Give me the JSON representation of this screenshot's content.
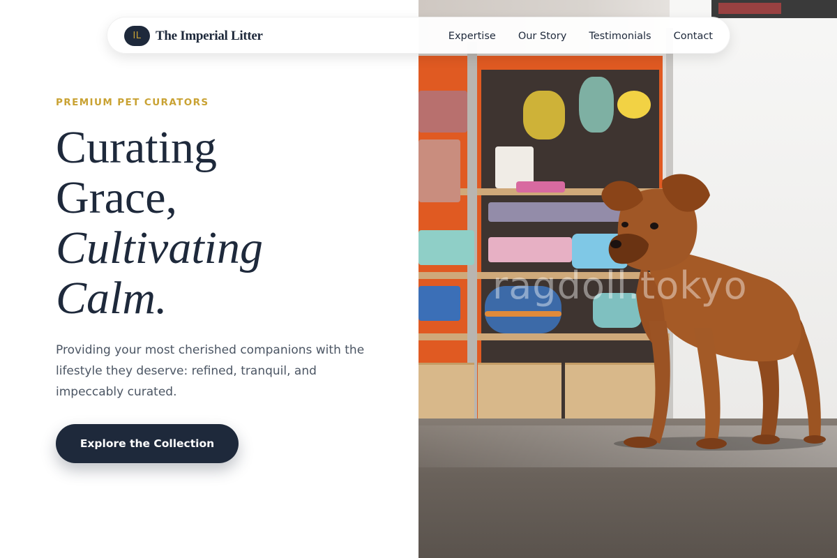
{
  "nav": {
    "brand_mark": "IL",
    "brand_name": "The Imperial Litter",
    "links": [
      "Expertise",
      "Our Story",
      "Testimonials",
      "Contact"
    ]
  },
  "hero": {
    "eyebrow": "PREMIUM PET CURATORS",
    "headline": [
      "Curating",
      "Grace,",
      "Cultivating",
      "Calm."
    ],
    "lede": "Providing your most cherished companions with the lifestyle they deserve: refined, tranquil, and impeccably curated.",
    "cta_label": "Explore the Collection"
  },
  "image": {
    "watermark": "ragdoll.tokyo"
  },
  "colors": {
    "navy": "#1e293b",
    "gold": "#c9a233",
    "body_text": "#4b5563"
  }
}
